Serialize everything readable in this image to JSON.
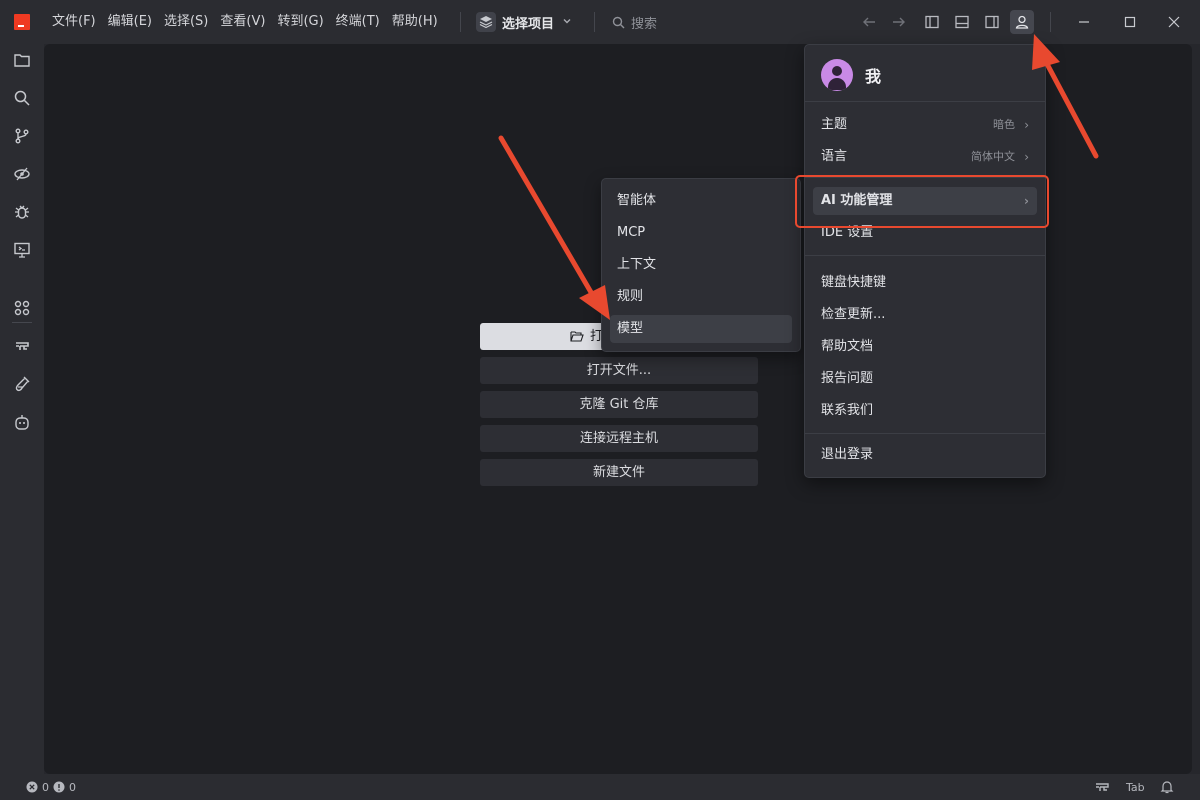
{
  "menubar": {
    "items": [
      "文件(F)",
      "编辑(E)",
      "选择(S)",
      "查看(V)",
      "转到(G)",
      "终端(T)",
      "帮助(H)"
    ]
  },
  "project": {
    "label": "选择项目"
  },
  "search": {
    "placeholder": "搜索"
  },
  "welcome": {
    "open_folder": "打",
    "open_file": "打开文件...",
    "clone": "克隆 Git 仓库",
    "remote": "连接远程主机",
    "new_file": "新建文件"
  },
  "submenu": {
    "items": [
      "智能体",
      "MCP",
      "上下文",
      "规则",
      "模型"
    ],
    "highlighted": "模型"
  },
  "usermenu": {
    "name": "我",
    "theme": {
      "label": "主题",
      "value": "暗色"
    },
    "language": {
      "label": "语言",
      "value": "简体中文"
    },
    "ai_manage": "AI 功能管理",
    "ide_settings": "IDE 设置",
    "shortcuts": "键盘快捷键",
    "check_updates": "检查更新...",
    "help_docs": "帮助文档",
    "report": "报告问题",
    "contact": "联系我们",
    "logout": "退出登录"
  },
  "statusbar": {
    "errors": "0",
    "warnings": "0",
    "tab": "Tab"
  },
  "colors": {
    "accent_red": "#e8492f",
    "logo": "#ef3a22",
    "avatar": "#c98ae6"
  }
}
